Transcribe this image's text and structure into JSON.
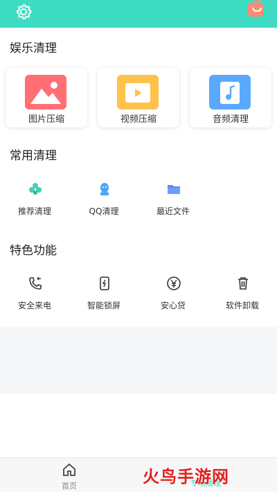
{
  "header": {
    "settings_icon": "gear-icon",
    "bag_icon": "shopping-bag-icon",
    "accent": "#3fdcc4"
  },
  "entertainment": {
    "title": "娱乐清理",
    "cards": [
      {
        "label": "图片压缩",
        "icon": "image-icon",
        "color": "#ff6f73"
      },
      {
        "label": "视频压缩",
        "icon": "video-icon",
        "color": "#ffc24a"
      },
      {
        "label": "音频清理",
        "icon": "music-icon",
        "color": "#5aa9ff"
      }
    ]
  },
  "common": {
    "title": "常用清理",
    "items": [
      {
        "label": "推荐清理",
        "icon": "clover-icon"
      },
      {
        "label": "QQ清理",
        "icon": "qq-icon"
      },
      {
        "label": "最近文件",
        "icon": "folder-icon"
      }
    ]
  },
  "features": {
    "title": "特色功能",
    "items": [
      {
        "label": "安全来电",
        "icon": "phone-icon"
      },
      {
        "label": "智能锁屏",
        "icon": "lock-screen-icon"
      },
      {
        "label": "安心贷",
        "icon": "yen-icon"
      },
      {
        "label": "软件卸载",
        "icon": "trash-icon"
      }
    ]
  },
  "tabbar": {
    "home_label": "首页",
    "clean_label": "专项清理"
  },
  "watermark": {
    "text": "火鸟手游网"
  }
}
